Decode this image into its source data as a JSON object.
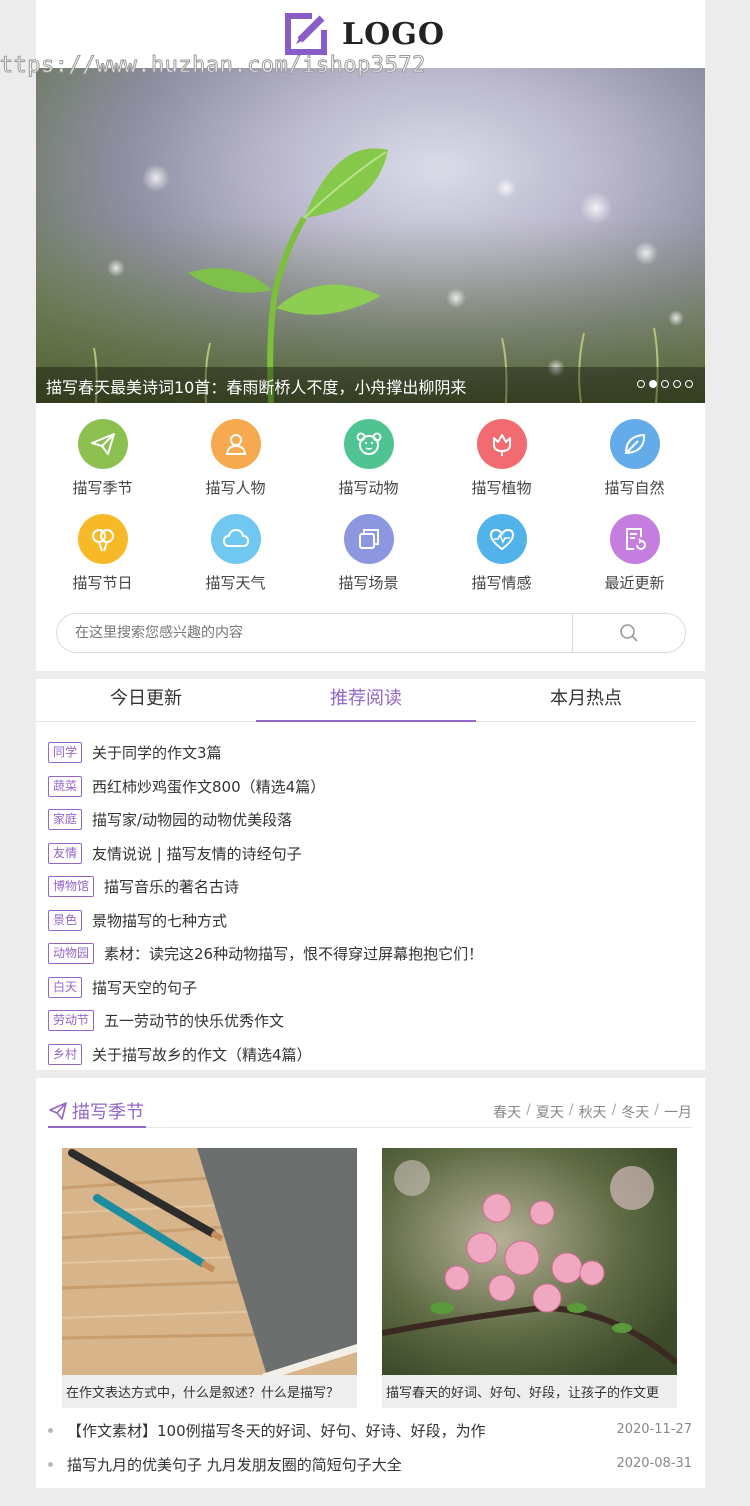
{
  "header": {
    "logo_text": "LOGO",
    "watermark": "https://www.huzhan.com/ishop3572"
  },
  "banner": {
    "caption": "描写春天最美诗词10首：春雨断桥人不度，小舟撑出柳阴来",
    "slides_total": 5,
    "active_slide": 2
  },
  "categories": [
    {
      "label": "描写季节",
      "icon": "paper-plane-icon",
      "color": "#8cc152"
    },
    {
      "label": "描写人物",
      "icon": "person-icon",
      "color": "#f6a94f"
    },
    {
      "label": "描写动物",
      "icon": "animal-face-icon",
      "color": "#4fc492"
    },
    {
      "label": "描写植物",
      "icon": "flower-icon",
      "color": "#f26b70"
    },
    {
      "label": "描写自然",
      "icon": "leaf-icon",
      "color": "#63abe9"
    },
    {
      "label": "描写节日",
      "icon": "balloon-icon",
      "color": "#f7b928"
    },
    {
      "label": "描写天气",
      "icon": "cloud-icon",
      "color": "#70c7ef"
    },
    {
      "label": "描写场景",
      "icon": "layers-icon",
      "color": "#8c97e0"
    },
    {
      "label": "描写情感",
      "icon": "heartbeat-icon",
      "color": "#52b3ea"
    },
    {
      "label": "最近更新",
      "icon": "document-refresh-icon",
      "color": "#c57ee0"
    }
  ],
  "search": {
    "placeholder": "在这里搜索您感兴趣的内容"
  },
  "tabs": [
    {
      "label": "今日更新",
      "active": false
    },
    {
      "label": "推荐阅读",
      "active": true
    },
    {
      "label": "本月热点",
      "active": false
    }
  ],
  "recommend_list": [
    {
      "tag": "同学",
      "title": "关于同学的作文3篇"
    },
    {
      "tag": "蔬菜",
      "title": "西红柿炒鸡蛋作文800（精选4篇）"
    },
    {
      "tag": "家庭",
      "title": "描写家/动物园的动物优美段落"
    },
    {
      "tag": "友情",
      "title": "友情说说 | 描写友情的诗经句子"
    },
    {
      "tag": "博物馆",
      "title": "描写音乐的著名古诗"
    },
    {
      "tag": "景色",
      "title": "景物描写的七种方式"
    },
    {
      "tag": "动物园",
      "title": "素材：读完这26种动物描写，恨不得穿过屏幕抱抱它们！"
    },
    {
      "tag": "白天",
      "title": "描写天空的句子"
    },
    {
      "tag": "劳动节",
      "title": "五一劳动节的快乐优秀作文"
    },
    {
      "tag": "乡村",
      "title": "关于描写故乡的作文（精选4篇）"
    }
  ],
  "season_section": {
    "title": "描写季节",
    "links": [
      "春天",
      "夏天",
      "秋天",
      "冬天",
      "一月"
    ],
    "cards": [
      {
        "caption": "在作文表达方式中，什么是叙述？什么是描写？"
      },
      {
        "caption": "描写春天的好词、好句、好段，让孩子的作文更"
      }
    ],
    "articles": [
      {
        "title": "【作文素材】100例描写冬天的好词、好句、好诗、好段，为作",
        "date": "2020-11-27"
      },
      {
        "title": "描写九月的优美句子 九月发朋友圈的简短句子大全",
        "date": "2020-08-31"
      }
    ]
  },
  "colors": {
    "accent": "#9466c8"
  }
}
